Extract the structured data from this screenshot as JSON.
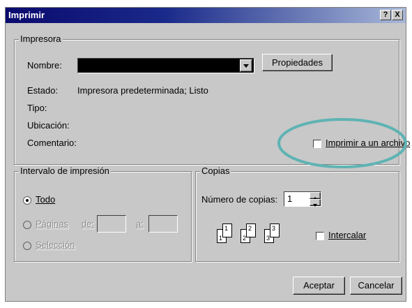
{
  "title": "Imprimir",
  "title_buttons": {
    "help": "?",
    "close": "X"
  },
  "printer": {
    "group_label": "Impresora",
    "name_label": "Nombre:",
    "name_value": "",
    "properties_button": "Propiedades",
    "status_label": "Estado:",
    "status_value": "Impresora predeterminada; Listo",
    "type_label": "Tipo:",
    "location_label": "Ubicación:",
    "comment_label": "Comentario:",
    "print_to_file": "Imprimir a un archivo",
    "print_to_file_checked": false
  },
  "range": {
    "group_label": "Intervalo de impresión",
    "all": "Todo",
    "pages": "Páginas",
    "from_label": "de:",
    "to_label": "a:",
    "selection": "Selección",
    "selected": "all"
  },
  "copies": {
    "group_label": "Copias",
    "count_label": "Número de copias:",
    "count_value": "1",
    "collate": "Intercalar",
    "collate_checked": false,
    "page_icons": [
      "1",
      "1",
      "2",
      "2",
      "3",
      "3"
    ]
  },
  "buttons": {
    "ok": "Aceptar",
    "cancel": "Cancelar"
  },
  "colors": {
    "highlight_ring": "#5fb3b3",
    "title_dark": "#0a0a6e"
  }
}
